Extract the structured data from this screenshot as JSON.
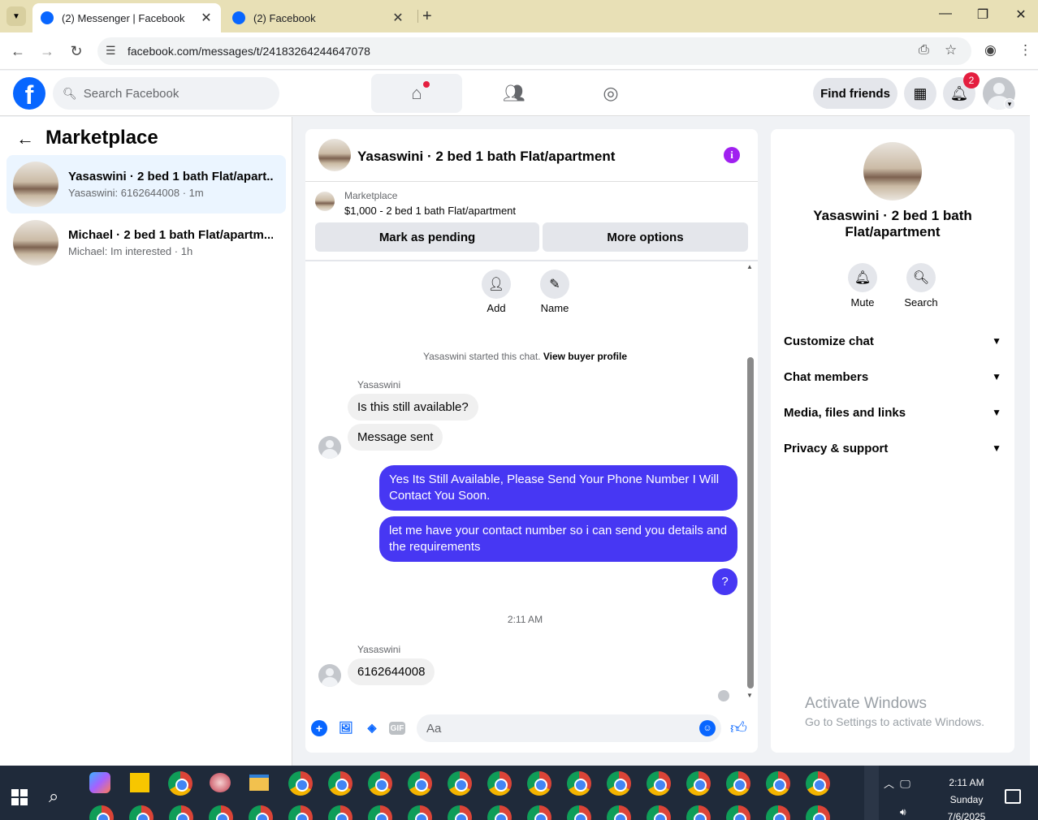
{
  "browser": {
    "tabs": [
      {
        "title": "(2) Messenger | Facebook",
        "active": true
      },
      {
        "title": "(2) Facebook",
        "active": false
      }
    ],
    "url": "facebook.com/messages/t/24183264244647078"
  },
  "header": {
    "search_placeholder": "Search Facebook",
    "find_friends": "Find friends",
    "notification_count": "2"
  },
  "sidebar": {
    "title": "Marketplace",
    "conversations": [
      {
        "name": "Yasaswini · 2 bed 1 bath Flat/apart...",
        "preview": "Yasaswini: 6162644008 · 1m"
      },
      {
        "name": "Michael · 2 bed 1 bath Flat/apartm...",
        "preview": "Michael: Im interested · 1h"
      }
    ]
  },
  "chat": {
    "title": "Yasaswini · 2 bed 1 bath Flat/apartment",
    "marketplace_label": "Marketplace",
    "listing": "$1,000 - 2 bed 1 bath Flat/apartment",
    "mark_pending": "Mark as pending",
    "more_options": "More options",
    "actions": {
      "add": "Add",
      "name": "Name"
    },
    "started_note": "Yasaswini started this chat.",
    "view_buyer_profile": "View buyer profile",
    "messages": [
      {
        "sender": "Yasaswini",
        "text": "Is this still available?"
      },
      {
        "text": "Message sent"
      },
      {
        "text": "Yes Its Still Available, Please Send Your Phone Number I Will Contact You Soon."
      },
      {
        "text": "let me have your contact number so i can send you details and the requirements"
      },
      {
        "text": "?"
      },
      {
        "sender": "Yasaswini",
        "text": "6162644008"
      }
    ],
    "timestamp": "2:11 AM",
    "composer_placeholder": "Aa",
    "gif_label": "GIF"
  },
  "details": {
    "title": "Yasaswini · 2 bed 1 bath Flat/apartment",
    "mute": "Mute",
    "search": "Search",
    "sections": [
      "Customize chat",
      "Chat members",
      "Media, files and links",
      "Privacy & support"
    ]
  },
  "watermark": {
    "line1": "Activate Windows",
    "line2": "Go to Settings to activate Windows."
  },
  "taskbar": {
    "time": "2:11 AM",
    "day": "Sunday",
    "date": "7/6/2025"
  },
  "colors": {
    "fb_blue": "#0866ff",
    "outgoing_bubble": "#4737f3",
    "info_purple": "#a020f0",
    "badge_red": "#e41e3f"
  }
}
